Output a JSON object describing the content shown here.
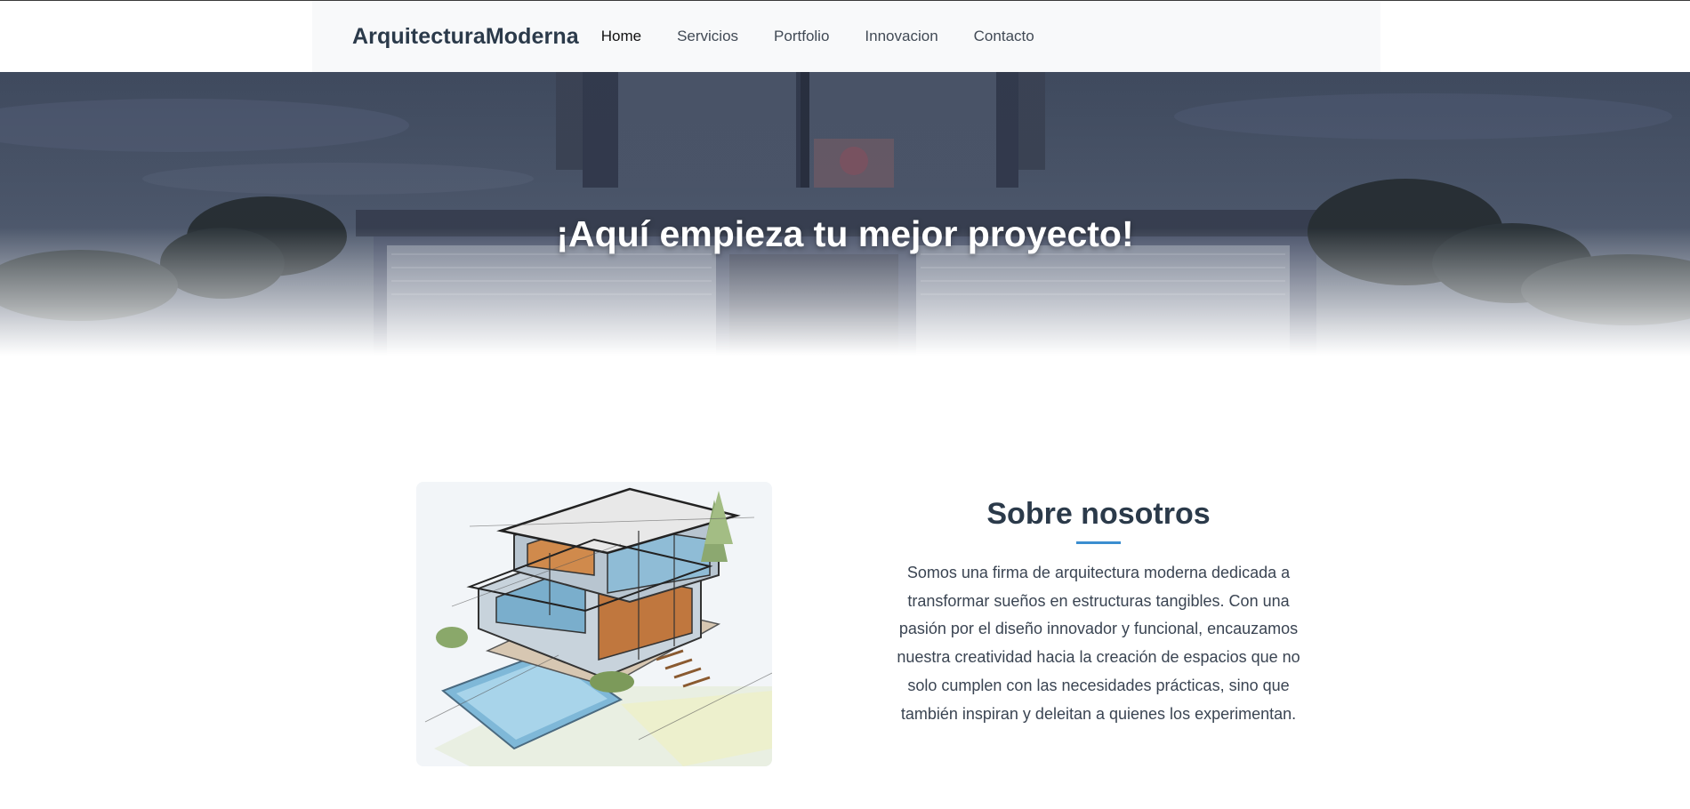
{
  "navbar": {
    "brand": "ArquitecturaModerna",
    "links": [
      {
        "label": "Home",
        "active": true
      },
      {
        "label": "Servicios",
        "active": false
      },
      {
        "label": "Portfolio",
        "active": false
      },
      {
        "label": "Innovacion",
        "active": false
      },
      {
        "label": "Contacto",
        "active": false
      }
    ]
  },
  "hero": {
    "title": "¡Aquí empieza tu mejor proyecto!"
  },
  "about": {
    "title": "Sobre nosotros",
    "body": "Somos una firma de arquitectura moderna dedicada a transformar sueños en estructuras tangibles. Con una pasión por el diseño innovador y funcional, encauzamos nuestra creatividad hacia la creación de espacios que no solo cumplen con las necesidades prácticas, sino que también inspiran y deleitan a quienes los experimentan.",
    "accent_color": "#3b8ed0"
  },
  "colors": {
    "navbar_bg": "#f8f9fa",
    "text_dark": "#2b3a4a",
    "hero_text": "#ffffff"
  }
}
